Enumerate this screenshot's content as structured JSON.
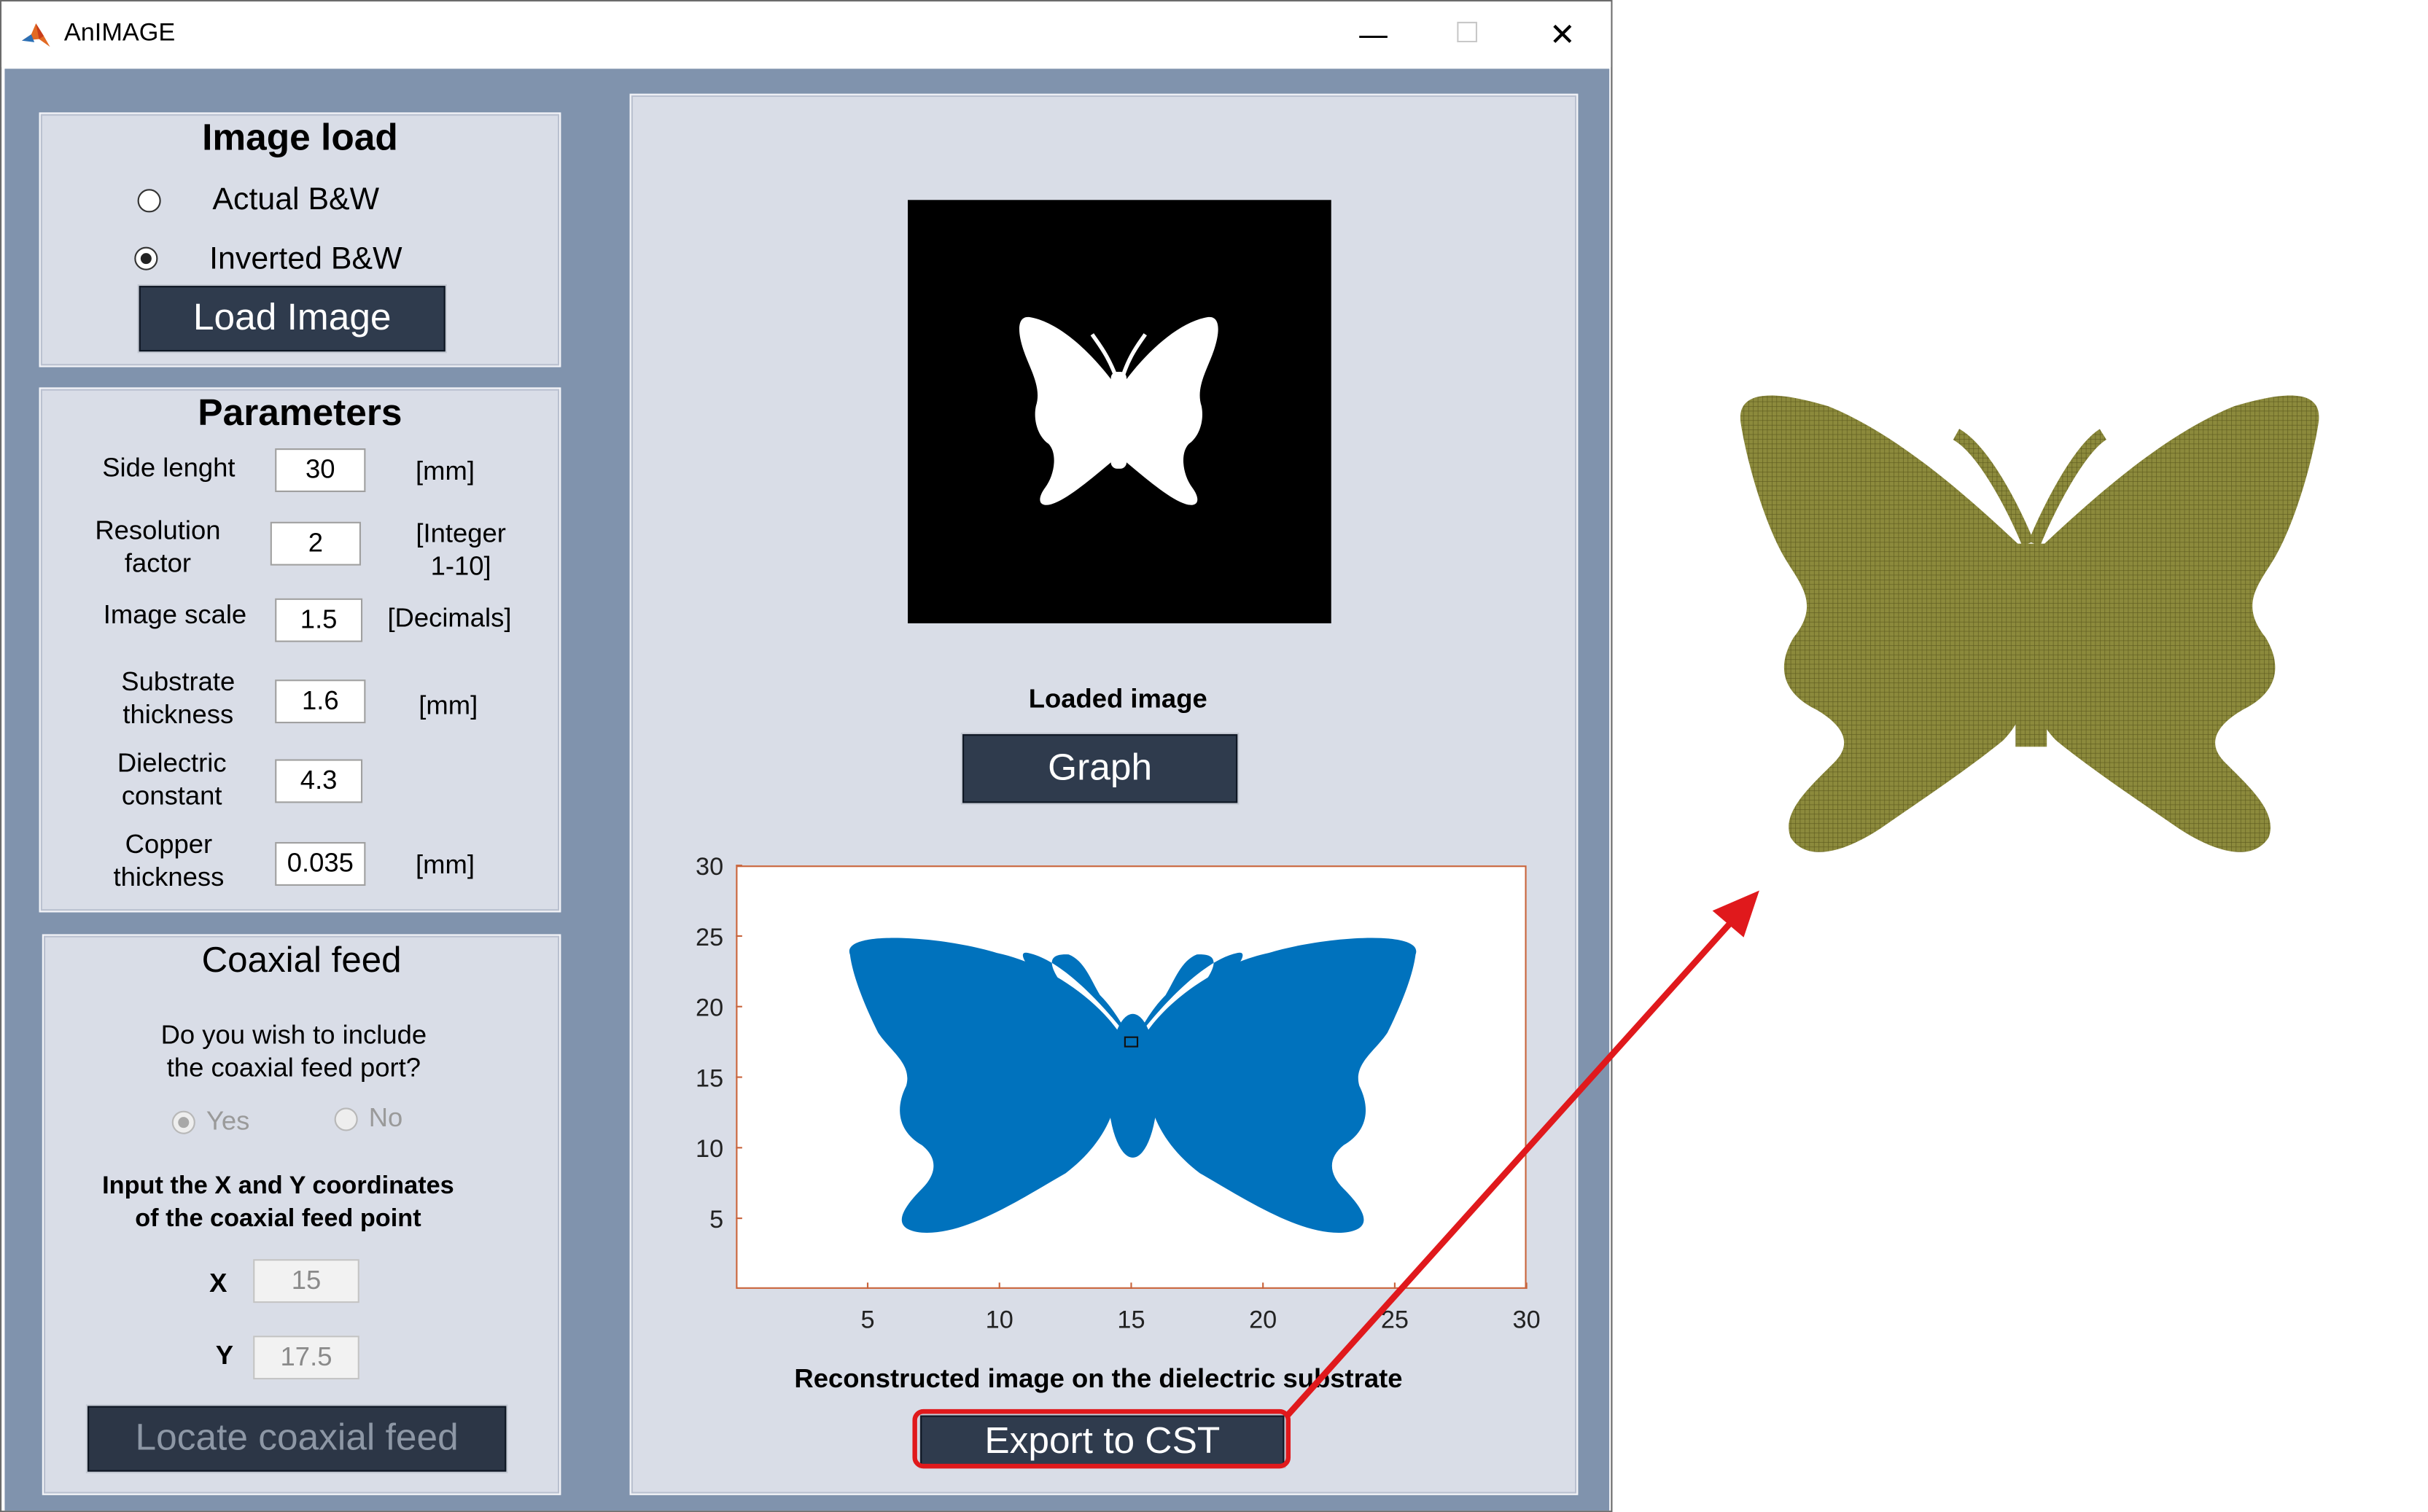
{
  "window": {
    "title": "AnIMAGE",
    "min_glyph": "—",
    "max_glyph": "☐",
    "close_glyph": "✕"
  },
  "image_load": {
    "title": "Image load",
    "option_actual": "Actual B&W",
    "option_inverted": "Inverted B&W",
    "selected": "Inverted B&W",
    "load_button": "Load Image"
  },
  "parameters": {
    "title": "Parameters",
    "side_length": {
      "label": "Side lenght",
      "value": "30",
      "unit": "[mm]"
    },
    "resolution": {
      "label_1": "Resolution",
      "label_2": "factor",
      "value": "2",
      "unit_1": "[Integer",
      "unit_2": "1-10]"
    },
    "image_scale": {
      "label": "Image scale",
      "value": "1.5",
      "unit": "[Decimals]"
    },
    "substrate": {
      "label_1": "Substrate",
      "label_2": "thickness",
      "value": "1.6",
      "unit": "[mm]"
    },
    "dielectric": {
      "label_1": "Dielectric",
      "label_2": "constant",
      "value": "4.3"
    },
    "copper": {
      "label_1": "Copper",
      "label_2": "thickness",
      "value": "0.035",
      "unit": "[mm]"
    }
  },
  "coaxial": {
    "title": "Coaxial feed",
    "question_1": "Do you wish to include",
    "question_2": "the coaxial feed port?",
    "yes": "Yes",
    "no": "No",
    "selected": "Yes",
    "instruction_1": "Input the X and Y coordinates",
    "instruction_2": "of the coaxial feed point",
    "x_label": "X",
    "x_value": "15",
    "y_label": "Y",
    "y_value": "17.5",
    "locate_button": "Locate coaxial feed"
  },
  "main": {
    "loaded_caption": "Loaded image",
    "graph_button": "Graph",
    "reconstructed_caption": "Reconstructed image on the dielectric substrate",
    "export_button": "Export to CST"
  },
  "chart_data": {
    "type": "scatter",
    "title": "",
    "xlabel": "",
    "ylabel": "",
    "xlim": [
      0,
      30
    ],
    "ylim": [
      0,
      30
    ],
    "xticks": [
      5,
      10,
      15,
      20,
      25,
      30
    ],
    "yticks": [
      5,
      10,
      15,
      20,
      25,
      30
    ],
    "y_tick_labels": [
      "30",
      "25",
      "20",
      "15",
      "10",
      "5"
    ],
    "x_tick_labels": [
      "5",
      "10",
      "15",
      "20",
      "25",
      "30"
    ],
    "grid": false,
    "marker_color": "#0072bd",
    "feed_point": {
      "x": 15,
      "y": 17.5
    }
  },
  "colors": {
    "panel_bg": "#d9dde7",
    "client_bg": "#8093ad",
    "button_bg": "#2f3b4d",
    "highlight": "#e0191c",
    "cst_fill": "#8c8a3c"
  }
}
